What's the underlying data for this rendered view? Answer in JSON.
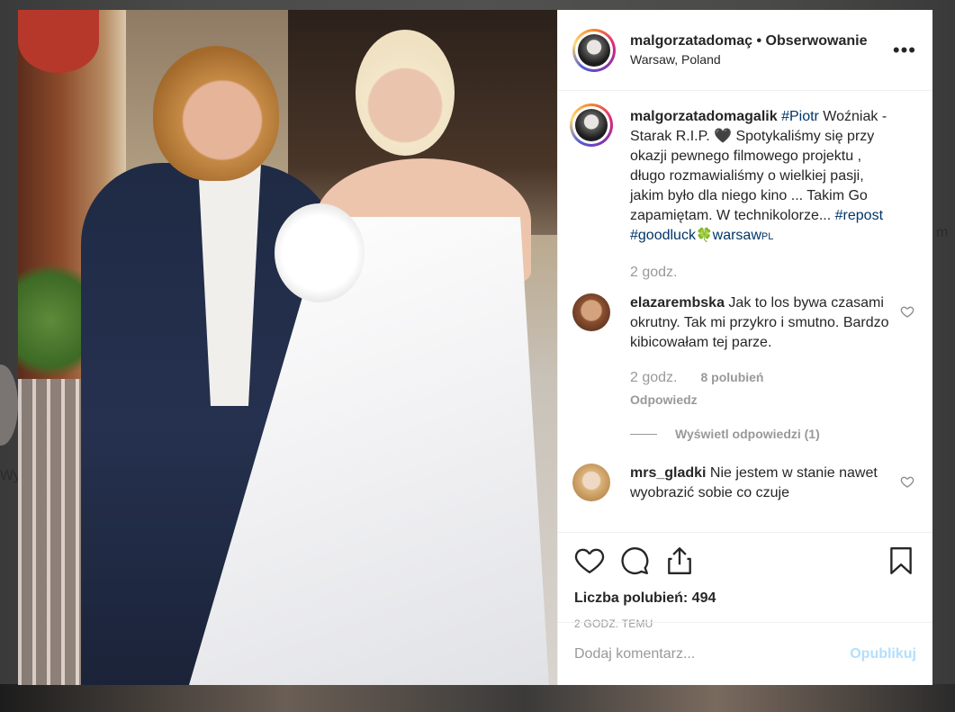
{
  "background": {
    "left_peek_text": "Wy",
    "right_peek_text": "m"
  },
  "post": {
    "header": {
      "username": "malgorzatadomaç",
      "separator": " • ",
      "follow_label": "Obserwowanie",
      "location": "Warsaw, Poland",
      "more_icon": "more-dots-icon"
    },
    "caption": {
      "username": "malgorzatadomagalik",
      "tag_piotr": "#Piotr",
      "text_1": " Woźniak - Starak R.I.P. 🖤 Spotykaliśmy się przy okazji pewnego filmowego projektu , długo rozmawialiśmy o wielkiej pasji, jakim było dla niego kino ... Takim Go zapamiętam. W technikolorze...",
      "tag_repost": "#repost",
      "tag_goodluck": "#goodluck",
      "clover": "🍀",
      "tag_warsaw": "warsaw",
      "tag_warsaw_suffix": "PL",
      "time": "2 godz."
    },
    "comments": [
      {
        "username": "elazarembska",
        "text": " Jak to los bywa czasami okrutny. Tak mi przykro i smutno. Bardzo kibicowałam tej parze.",
        "time": "2 godz.",
        "likes": "8 polubień",
        "reply_label": "Odpowiedz",
        "view_replies": "Wyświetl odpowiedzi (1)",
        "avatar_color": "#a0603a"
      },
      {
        "username": "mrs_gladki",
        "text": " Nie jestem w stanie nawet wyobrazić sobie co czuje",
        "avatar_color": "#d9b27a"
      }
    ],
    "likes_label": "Liczba polubień: 494",
    "time_ago": "2 GODZ. TEMU",
    "comment_placeholder": "Dodaj komentarz...",
    "publish_label": "Opublikuj",
    "colors": {
      "link": "#003569",
      "muted": "#999999",
      "publish_disabled": "#b2dffc"
    }
  }
}
